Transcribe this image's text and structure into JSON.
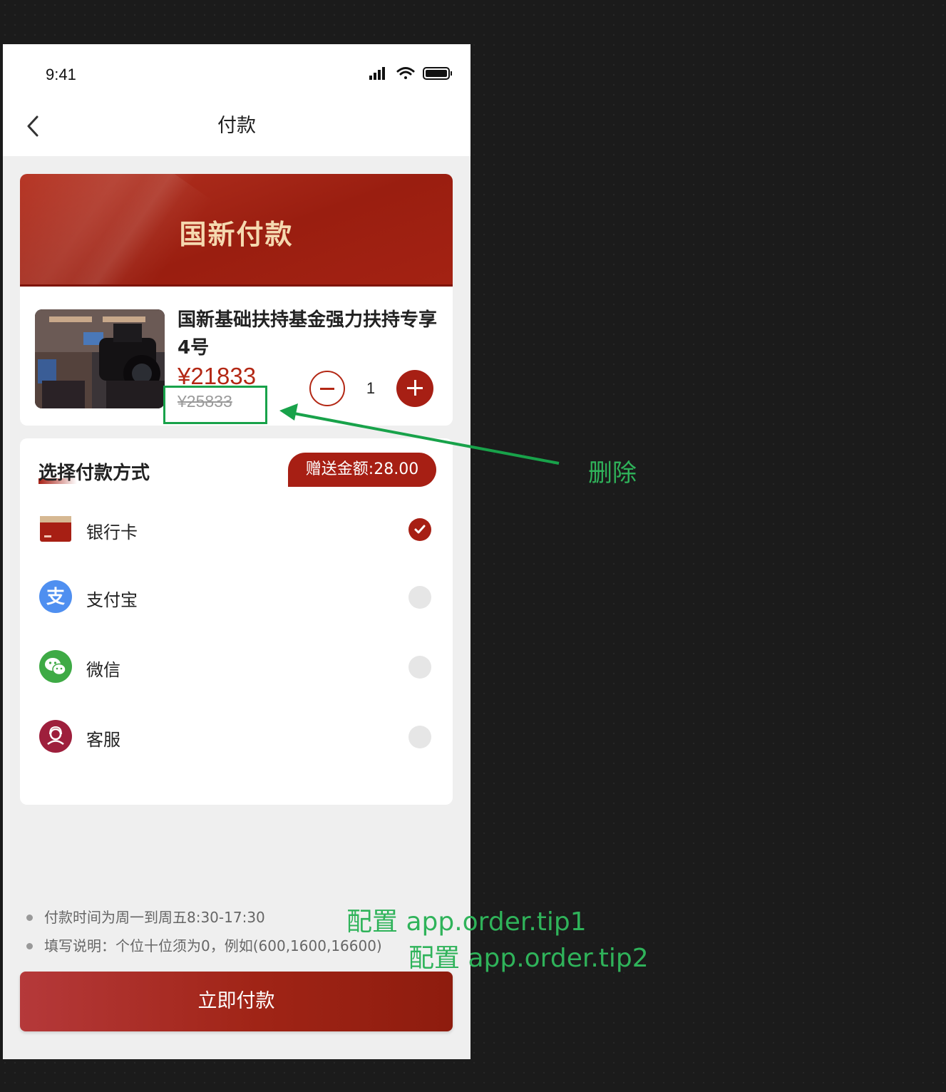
{
  "status_bar": {
    "time": "9:41"
  },
  "nav": {
    "title": "付款"
  },
  "banner": {
    "title": "国新付款"
  },
  "product": {
    "name": "国新基础扶持基金强力扶持专享4号",
    "price": "¥21833",
    "original_price": "¥25833",
    "quantity": "1"
  },
  "payment": {
    "title": "选择付款方式",
    "bonus": "赠送金额:28.00",
    "methods": [
      {
        "label": "银行卡",
        "icon": "bank-card-icon",
        "selected": true
      },
      {
        "label": "支付宝",
        "icon": "alipay-icon",
        "selected": false
      },
      {
        "label": "微信",
        "icon": "wechat-icon",
        "selected": false
      },
      {
        "label": "客服",
        "icon": "customer-service-icon",
        "selected": false
      }
    ]
  },
  "tips": [
    "付款时间为周一到周五8:30-17:30",
    "填写说明：个位十位须为0，例如(600,1600,16600)"
  ],
  "submit": {
    "label": "立即付款"
  },
  "annotations": {
    "delete": "删除",
    "tip1": "配置 app.order.tip1",
    "tip2": "配置 app.order.tip2"
  },
  "colors": {
    "accent": "#a71f14",
    "banner_text": "#f5d9b0",
    "annotation": "#2fb35a"
  }
}
